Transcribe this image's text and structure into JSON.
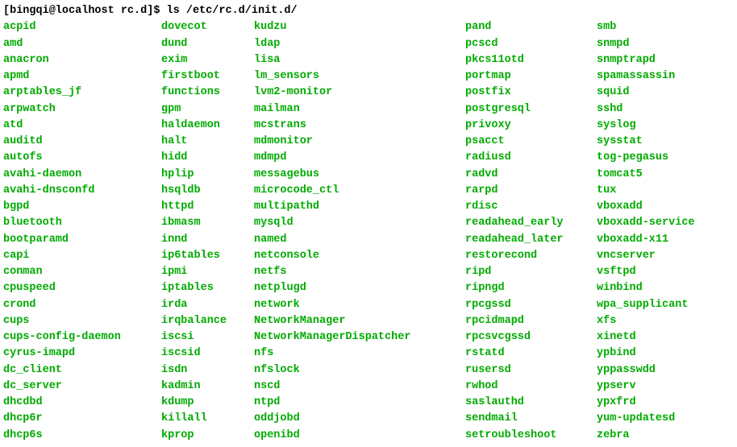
{
  "prompt": {
    "user_host": "[bingqi@localhost rc.d]$",
    "command": "ls /etc/rc.d/init.d/"
  },
  "columns": [
    [
      "acpid",
      "amd",
      "anacron",
      "apmd",
      "arptables_jf",
      "arpwatch",
      "atd",
      "auditd",
      "autofs",
      "avahi-daemon",
      "avahi-dnsconfd",
      "bgpd",
      "bluetooth",
      "bootparamd",
      "capi",
      "conman",
      "cpuspeed",
      "crond",
      "cups",
      "cups-config-daemon",
      "cyrus-imapd",
      "dc_client",
      "dc_server",
      "dhcdbd",
      "dhcp6r",
      "dhcp6s"
    ],
    [
      "dovecot",
      "dund",
      "exim",
      "firstboot",
      "functions",
      "gpm",
      "haldaemon",
      "halt",
      "hidd",
      "hplip",
      "hsqldb",
      "httpd",
      "ibmasm",
      "innd",
      "ip6tables",
      "ipmi",
      "iptables",
      "irda",
      "irqbalance",
      "iscsi",
      "iscsid",
      "isdn",
      "kadmin",
      "kdump",
      "killall",
      "kprop"
    ],
    [
      "kudzu",
      "ldap",
      "lisa",
      "lm_sensors",
      "lvm2-monitor",
      "mailman",
      "mcstrans",
      "mdmonitor",
      "mdmpd",
      "messagebus",
      "microcode_ctl",
      "multipathd",
      "mysqld",
      "named",
      "netconsole",
      "netfs",
      "netplugd",
      "network",
      "NetworkManager",
      "NetworkManagerDispatcher",
      "nfs",
      "nfslock",
      "nscd",
      "ntpd",
      "oddjobd",
      "openibd"
    ],
    [
      "pand",
      "pcscd",
      "pkcs11otd",
      "portmap",
      "postfix",
      "postgresql",
      "privoxy",
      "psacct",
      "radiusd",
      "radvd",
      "rarpd",
      "rdisc",
      "readahead_early",
      "readahead_later",
      "restorecond",
      "ripd",
      "ripngd",
      "rpcgssd",
      "rpcidmapd",
      "rpcsvcgssd",
      "rstatd",
      "rusersd",
      "rwhod",
      "saslauthd",
      "sendmail",
      "setroubleshoot"
    ],
    [
      "smb",
      "snmpd",
      "snmptrapd",
      "spamassassin",
      "squid",
      "sshd",
      "syslog",
      "sysstat",
      "tog-pegasus",
      "tomcat5",
      "tux",
      "vboxadd",
      "vboxadd-service",
      "vboxadd-x11",
      "vncserver",
      "vsftpd",
      "winbind",
      "wpa_supplicant",
      "xfs",
      "xinetd",
      "ypbind",
      "yppasswdd",
      "ypserv",
      "ypxfrd",
      "yum-updatesd",
      "zebra"
    ]
  ]
}
